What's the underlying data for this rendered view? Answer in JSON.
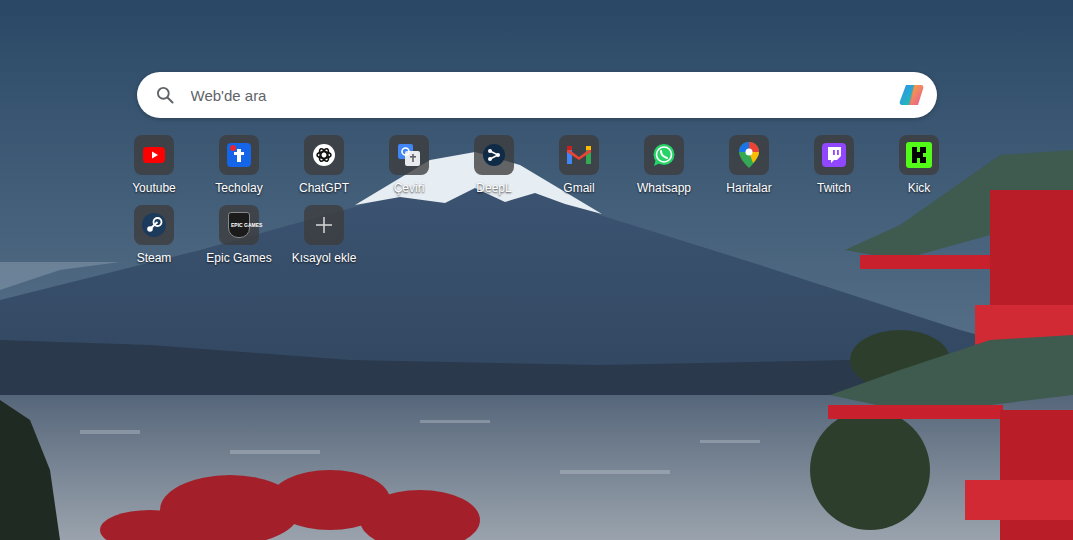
{
  "search": {
    "placeholder": "Web'de ara"
  },
  "shortcuts": [
    {
      "label": "Youtube",
      "kind": "site"
    },
    {
      "label": "Techolay",
      "kind": "site"
    },
    {
      "label": "ChatGPT",
      "kind": "site"
    },
    {
      "label": "Çeviri",
      "kind": "site"
    },
    {
      "label": "DeepL",
      "kind": "site"
    },
    {
      "label": "Gmail",
      "kind": "site"
    },
    {
      "label": "Whatsapp",
      "kind": "site"
    },
    {
      "label": "Haritalar",
      "kind": "site"
    },
    {
      "label": "Twitch",
      "kind": "site"
    },
    {
      "label": "Kick",
      "kind": "site"
    },
    {
      "label": "Steam",
      "kind": "site"
    },
    {
      "label": "Epic Games",
      "kind": "site",
      "badge": "EPIC GAMES"
    },
    {
      "label": "Kısayol ekle",
      "kind": "add"
    }
  ]
}
